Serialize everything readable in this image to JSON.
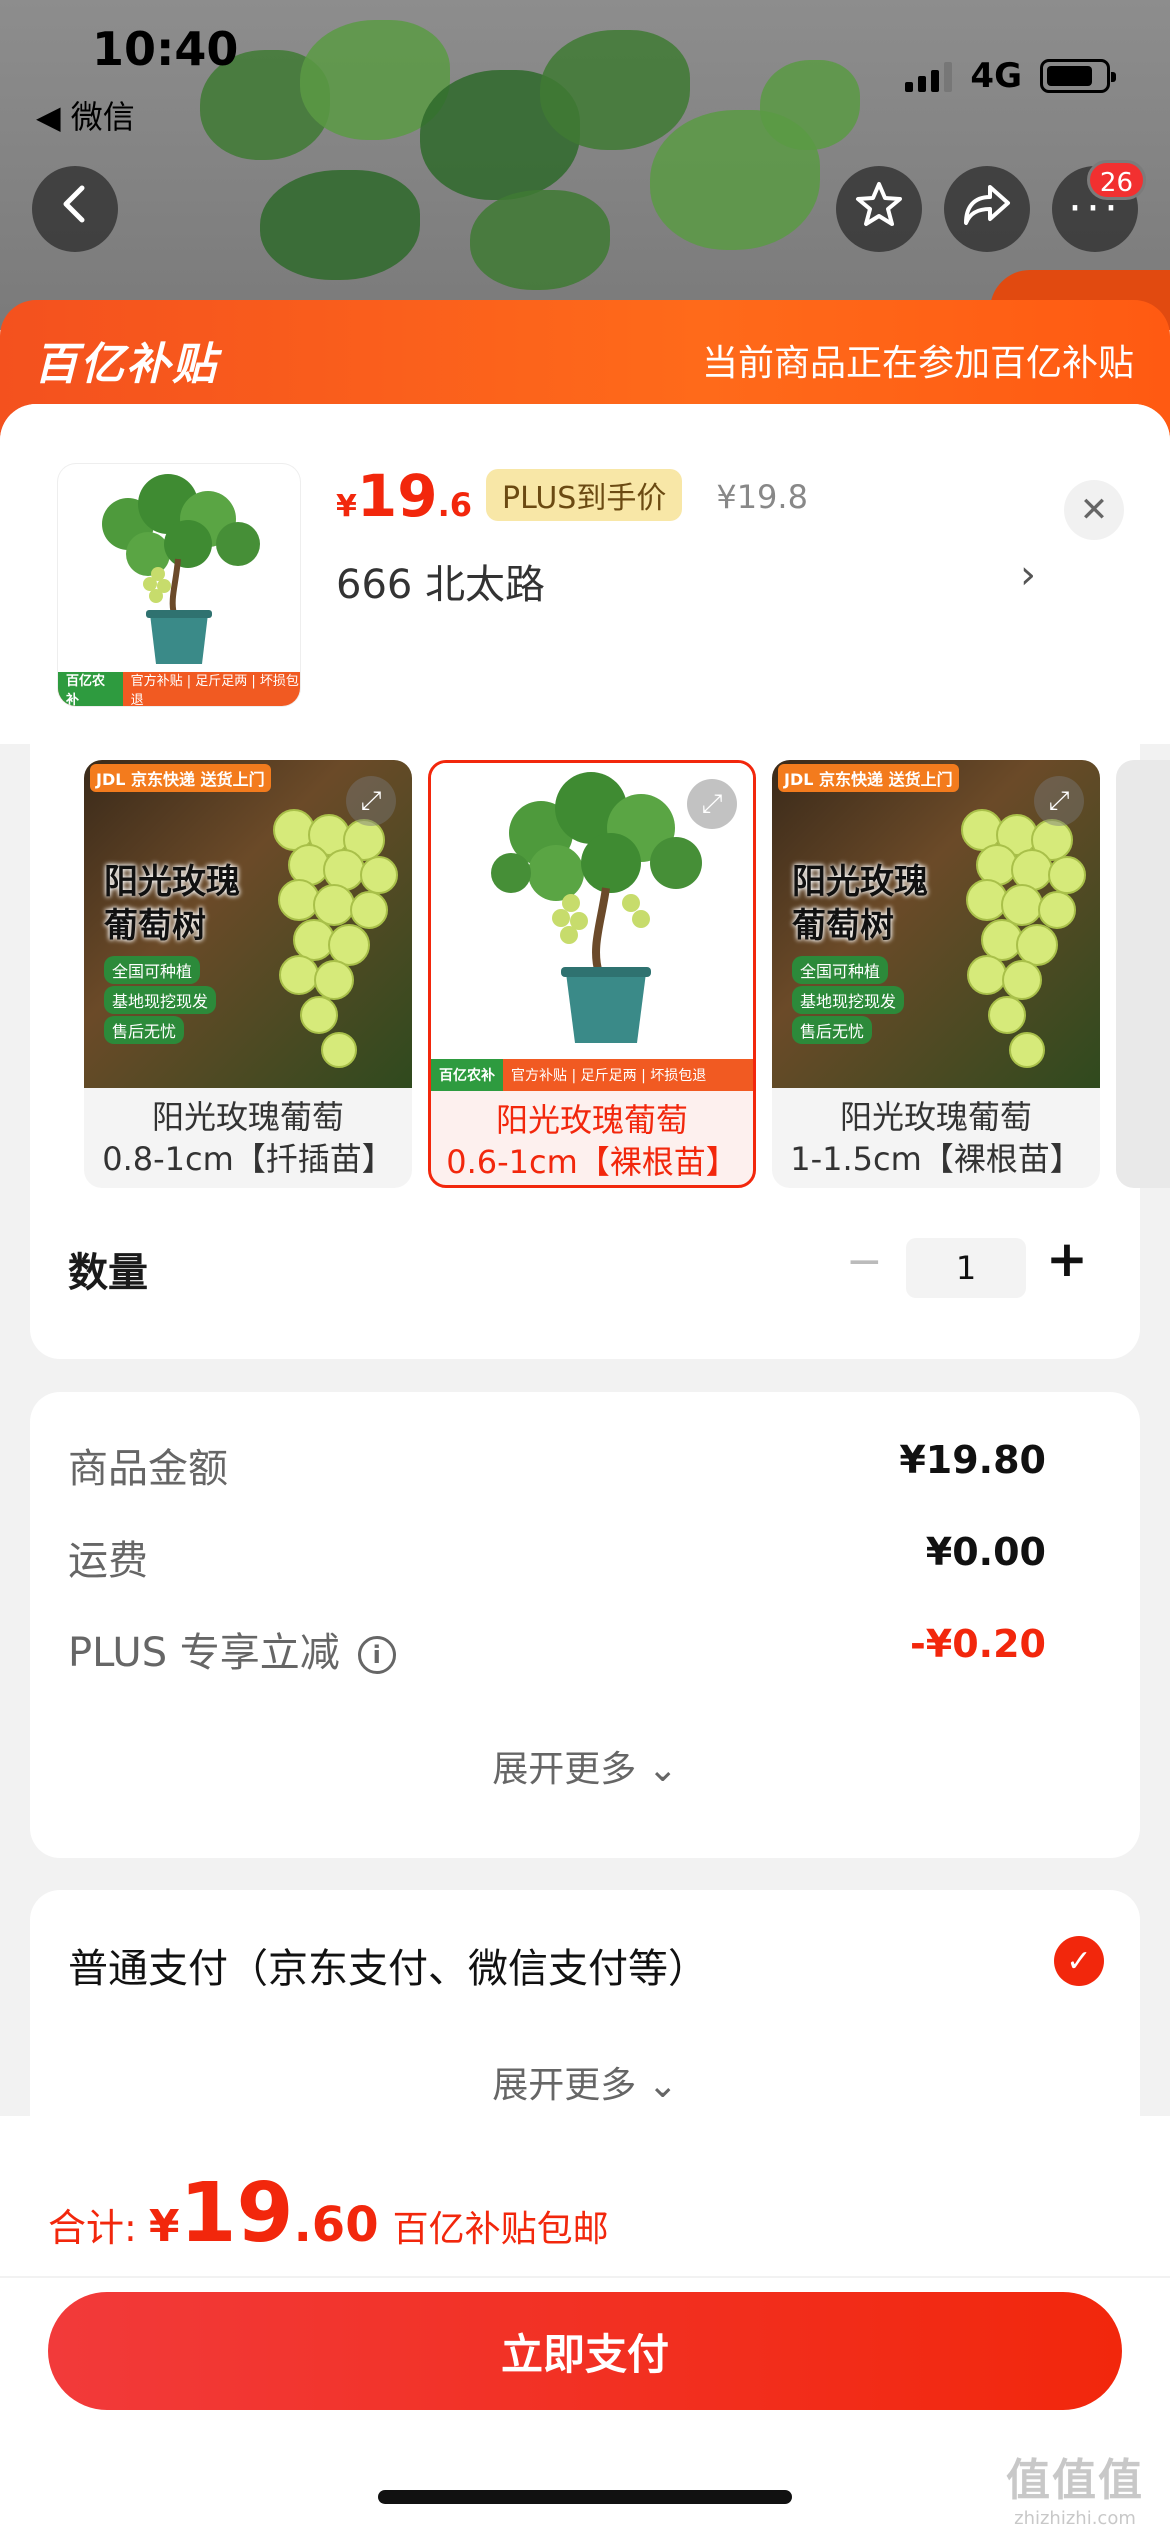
{
  "status_bar": {
    "time": "10:40",
    "back_app": "◀ 微信",
    "network": "4G"
  },
  "nav": {
    "cart_count": "26"
  },
  "banner": {
    "logo": "百亿补贴",
    "text": "当前商品正在参加百亿补贴"
  },
  "product": {
    "price_symbol": "¥",
    "price_int": "19",
    "price_dec": ".6",
    "plus_badge": "PLUS到手价",
    "original_price": "¥19.8",
    "address": "666  北太路",
    "thumb_strip_left": "百亿农补",
    "thumb_strip_right": "官方补贴 | 足斤足两 | 坏损包退"
  },
  "variants": [
    {
      "line1": "阳光玫瑰葡萄",
      "line2": "0.8-1cm【扦插苗】",
      "selected": false,
      "tag": "JDL 京东快递 送货上门",
      "title": "阳光玫瑰 葡萄树",
      "features": [
        "全国可种植",
        "基地现挖现发",
        "售后无忧"
      ]
    },
    {
      "line1": "阳光玫瑰葡萄",
      "line2": "0.6-1cm【裸根苗】",
      "selected": true,
      "strip_left": "百亿农补",
      "strip_right": "官方补贴 | 足斤足两 | 坏损包退"
    },
    {
      "line1": "阳光玫瑰葡萄",
      "line2": "1-1.5cm【裸根苗】",
      "selected": false,
      "tag": "JDL 京东快递 送货上门",
      "title": "阳光玫瑰 葡萄树",
      "features": [
        "全国可种植",
        "基地现挖现发",
        "售后无忧"
      ]
    }
  ],
  "quantity": {
    "label": "数量",
    "minus": "−",
    "value": "1",
    "plus": "+"
  },
  "costs": {
    "goods_label": "商品金额",
    "goods_value": "¥19.80",
    "shipping_label": "运费",
    "shipping_value": "¥0.00",
    "plus_label": "PLUS 专享立减",
    "plus_value": "-¥0.20",
    "expand": "展开更多 ⌄"
  },
  "payment": {
    "method": "普通支付（京东支付、微信支付等）",
    "expand": "展开更多 ⌄"
  },
  "total": {
    "label": "合计:",
    "yen": "¥",
    "int": "19",
    "dec": ".60",
    "note": "百亿补贴包邮"
  },
  "pay_button": "立即支付",
  "watermark": {
    "big": "值值值",
    "small": "zhizhizhi.com"
  },
  "colors": {
    "accent": "#f2270c",
    "banner": "#ff5a12",
    "plus_badge_bg": "#f8e7a7",
    "leaf_green": "#3f7a34"
  }
}
